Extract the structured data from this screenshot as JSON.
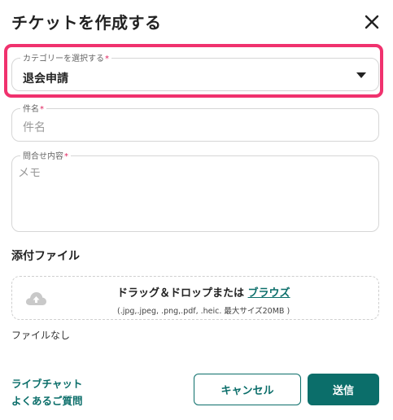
{
  "header": {
    "title": "チケットを作成する"
  },
  "form": {
    "category": {
      "label": "カテゴリーを選択する",
      "required_mark": "*",
      "value": "退会申請"
    },
    "subject": {
      "label": "件名",
      "required_mark": "*",
      "placeholder": "件名"
    },
    "inquiry": {
      "label": "問合せ内容",
      "required_mark": "*",
      "placeholder": "メモ"
    }
  },
  "attachments": {
    "section_label": "添付ファイル",
    "drop_text": "ドラッグ＆ドロップまたは",
    "browse_label": "ブラウズ",
    "formats_text": "(.jpg,.jpeg, .png,.pdf, .heic. 最大サイズ20MB )",
    "no_file_text": "ファイルなし"
  },
  "footer": {
    "live_chat_label": "ライブチャット",
    "faq_label": "よくあるご質問",
    "cancel_label": "キャンセル",
    "send_label": "送信"
  },
  "colors": {
    "accent": "#0b6e6a",
    "highlight": "#f0326e",
    "required": "#e0245e"
  },
  "icons": {
    "close": "close-icon",
    "dropdown": "caret-down-icon",
    "upload": "cloud-upload-icon"
  }
}
